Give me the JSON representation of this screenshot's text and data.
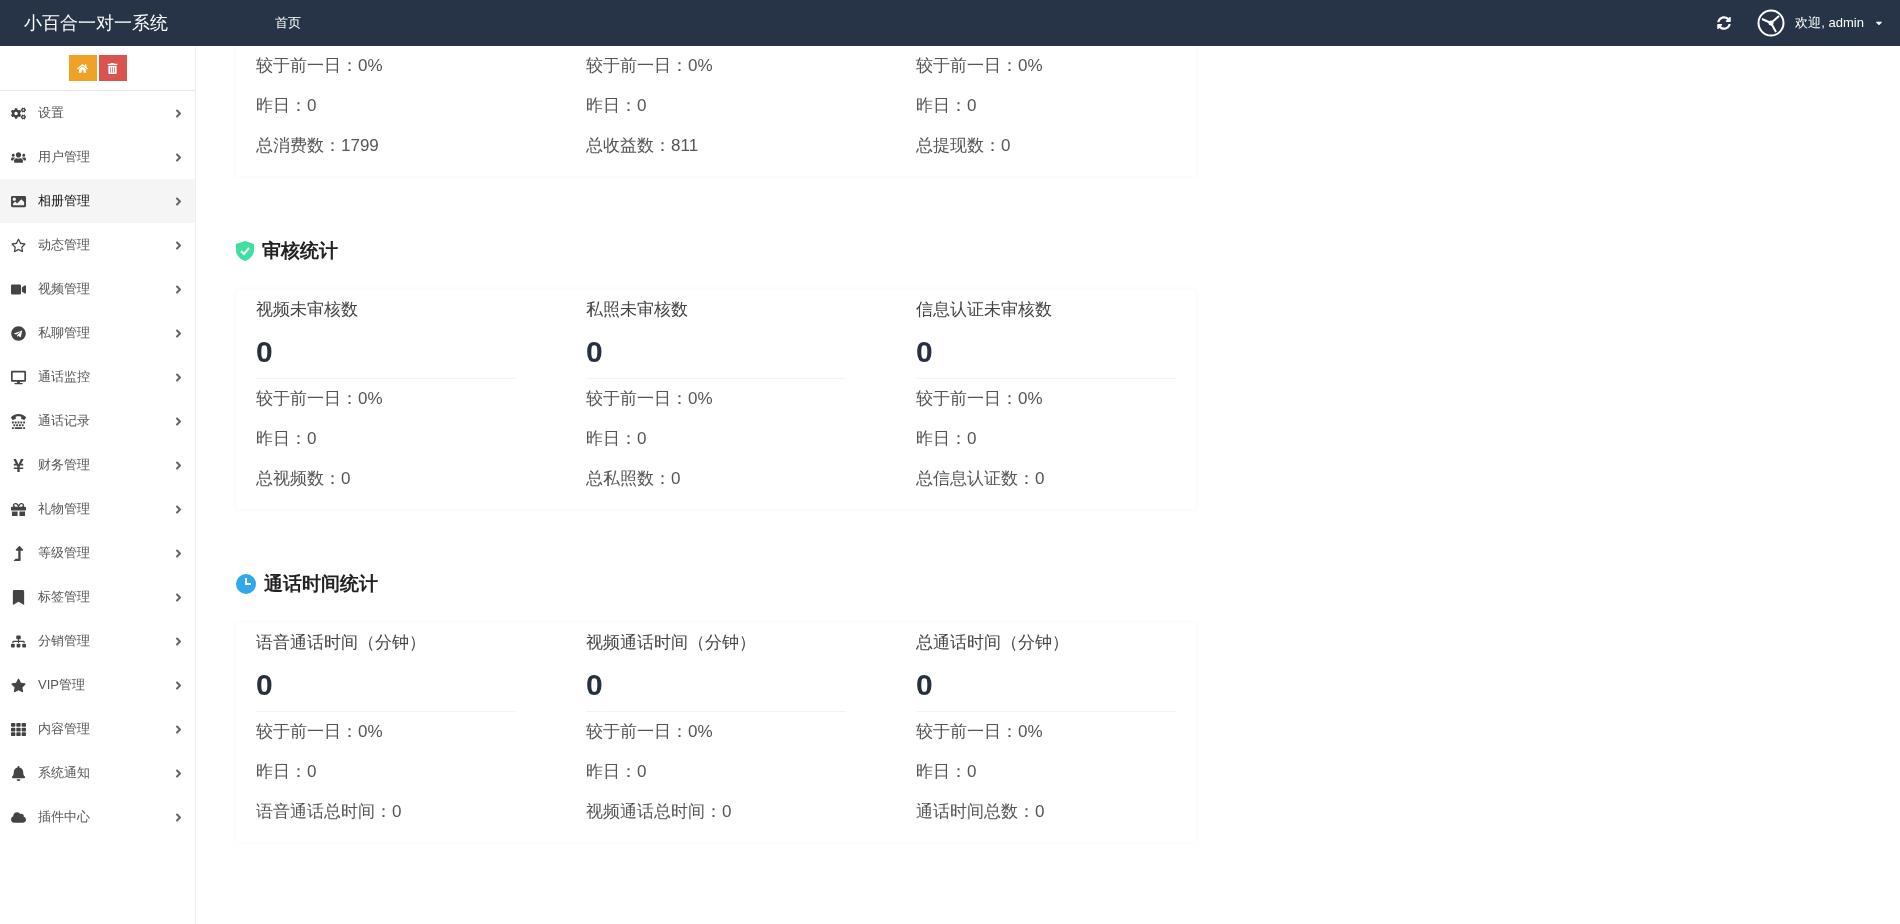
{
  "header": {
    "title": "小百合一对一系统",
    "nav": [
      {
        "label": "首页",
        "selected": false
      }
    ],
    "user": "欢迎, admin"
  },
  "sidebar": {
    "quick_buttons": [
      {
        "kind": "home"
      },
      {
        "kind": "trash"
      }
    ],
    "items": [
      {
        "label": "设置",
        "selected": false
      },
      {
        "label": "用户管理",
        "selected": false
      },
      {
        "label": "相册管理",
        "selected": true
      },
      {
        "label": "动态管理",
        "selected": false
      },
      {
        "label": "视频管理",
        "selected": false
      },
      {
        "label": "私聊管理",
        "selected": false
      },
      {
        "label": "通话监控",
        "selected": false
      },
      {
        "label": "通话记录",
        "selected": false
      },
      {
        "label": "财务管理",
        "selected": false
      },
      {
        "label": "礼物管理",
        "selected": false
      },
      {
        "label": "等级管理",
        "selected": false
      },
      {
        "label": "标签管理",
        "selected": false
      },
      {
        "label": "分销管理",
        "selected": false
      },
      {
        "label": "VIP管理",
        "selected": false
      },
      {
        "label": "内容管理",
        "selected": false
      },
      {
        "label": "系统通知",
        "selected": false
      },
      {
        "label": "插件中心",
        "selected": false
      }
    ]
  },
  "sections": [
    {
      "cards": [
        {
          "rows": [
            "较于前一日：0%",
            "昨日：0",
            "总消费数：1799"
          ]
        },
        {
          "rows": [
            "较于前一日：0%",
            "昨日：0",
            "总收益数：811"
          ]
        },
        {
          "rows": [
            "较于前一日：0%",
            "昨日：0",
            "总提现数：0"
          ]
        }
      ]
    },
    {
      "title": "审核统计",
      "cards": [
        {
          "label": "视频未审核数",
          "value": "0",
          "rows": [
            "较于前一日：0%",
            "昨日：0",
            "总视频数：0"
          ]
        },
        {
          "label": "私照未审核数",
          "value": "0",
          "rows": [
            "较于前一日：0%",
            "昨日：0",
            "总私照数：0"
          ]
        },
        {
          "label": "信息认证未审核数",
          "value": "0",
          "rows": [
            "较于前一日：0%",
            "昨日：0",
            "总信息认证数：0"
          ]
        }
      ]
    },
    {
      "title": "通话时间统计",
      "cards": [
        {
          "label": "语音通话时间（分钟）",
          "value": "0",
          "rows": [
            "较于前一日：0%",
            "昨日：0",
            "语音通话总时间：0"
          ]
        },
        {
          "label": "视频通话时间（分钟）",
          "value": "0",
          "rows": [
            "较于前一日：0%",
            "昨日：0",
            "视频通话总时间：0"
          ]
        },
        {
          "label": "总通话时间（分钟）",
          "value": "0",
          "rows": [
            "较于前一日：0%",
            "昨日：0",
            "通话时间总数：0"
          ]
        }
      ]
    }
  ]
}
